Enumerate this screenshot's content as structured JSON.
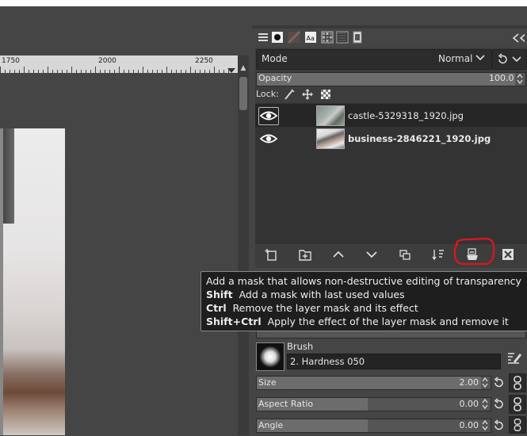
{
  "ruler": {
    "labels": [
      "1750",
      "2000",
      "2250"
    ]
  },
  "dock": {
    "tabs": [
      {
        "icon": "brush-tab-icon"
      },
      {
        "icon": "pattern-tab-icon"
      },
      {
        "icon": "font-tab-icon"
      },
      {
        "icon": "palette-tab-icon"
      },
      {
        "icon": "tool-presets-tab-icon"
      },
      {
        "icon": "document-tab-icon"
      }
    ]
  },
  "layers": {
    "mode_label": "Mode",
    "mode_value": "Normal",
    "opacity_label": "Opacity",
    "opacity_value": "100.0",
    "lock_label": "Lock:",
    "items": [
      {
        "name": "castle-5329318_1920.jpg",
        "visible": true,
        "selected": true
      },
      {
        "name": "business-2846221_1920.jpg",
        "visible": true,
        "selected": false
      }
    ]
  },
  "tooltip": {
    "line0": "Add a mask that allows non-destructive editing of transparency",
    "line1_key": "Shift",
    "line1_text": "Add a mask with last used values",
    "line2_key": "Ctrl",
    "line2_text": "Remove the layer mask and its effect",
    "line3_key": "Shift+Ctrl",
    "line3_text": "Apply the effect of the layer mask and remove it"
  },
  "tool_options": {
    "brush_label": "Brush",
    "brush_value": "2. Hardness 050",
    "size_label": "Size",
    "size_value": "2.00",
    "aspect_label": "Aspect Ratio",
    "aspect_value": "0.00",
    "angle_label": "Angle",
    "angle_value": "0.00"
  },
  "colors": {
    "highlight_ring": "#e0151c",
    "panel_bg": "#454545",
    "selected_row": "#262626"
  }
}
